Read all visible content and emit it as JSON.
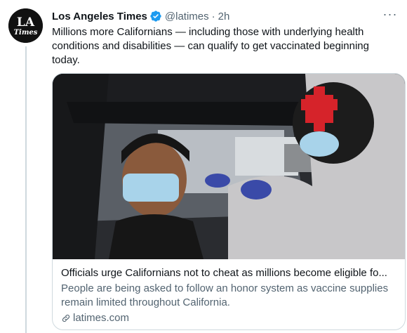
{
  "tweet": {
    "display_name": "Los Angeles Times",
    "handle": "@latimes",
    "separator": "·",
    "timestamp": "2h",
    "more_label": "···",
    "text": "Millions more Californians — including those with underlying health conditions and disabilities — can qualify to get vaccinated beginning today."
  },
  "avatar": {
    "logo_text_top": "LA",
    "logo_text_bottom": "Times"
  },
  "card": {
    "title": "Officials urge Californians not to cheat as millions become eligible fo...",
    "description": "People are being asked to follow an honor system as vaccine supplies remain limited throughout California.",
    "domain": "latimes.com"
  },
  "icons": {
    "verified": "verified-badge-icon",
    "more": "more-options-icon",
    "link": "link-icon"
  },
  "colors": {
    "verified_blue": "#1d9bf0",
    "secondary_text": "#536471",
    "primary_text": "#0f1419",
    "border": "#cfd9de"
  }
}
